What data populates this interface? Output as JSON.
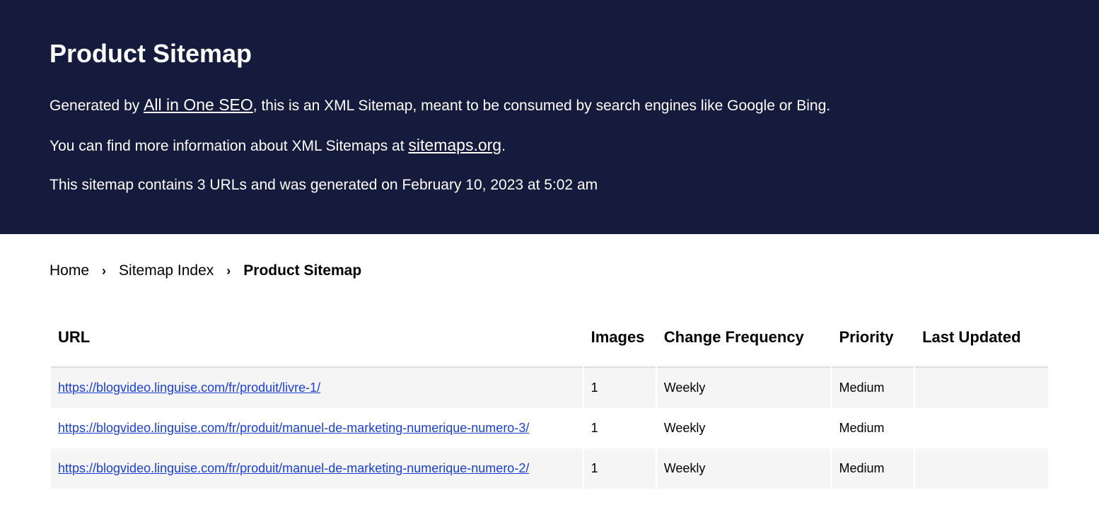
{
  "header": {
    "title": "Product Sitemap",
    "line1_prefix": "Generated by ",
    "line1_link": "All in One SEO",
    "line1_suffix": ", this is an XML Sitemap, meant to be consumed by search engines like Google or Bing.",
    "line2_prefix": "You can find more information about XML Sitemaps at ",
    "line2_link": "sitemaps.org",
    "line2_suffix": ".",
    "line3": "This sitemap contains 3 URLs and was generated on February 10, 2023 at 5:02 am"
  },
  "breadcrumb": {
    "home": "Home",
    "index": "Sitemap Index",
    "current": "Product Sitemap"
  },
  "table": {
    "headers": {
      "url": "URL",
      "images": "Images",
      "freq": "Change Frequency",
      "priority": "Priority",
      "updated": "Last Updated"
    },
    "rows": [
      {
        "url": "https://blogvideo.linguise.com/fr/produit/livre-1/",
        "images": "1",
        "freq": "Weekly",
        "priority": "Medium",
        "updated": ""
      },
      {
        "url": "https://blogvideo.linguise.com/fr/produit/manuel-de-marketing-numerique-numero-3/",
        "images": "1",
        "freq": "Weekly",
        "priority": "Medium",
        "updated": ""
      },
      {
        "url": "https://blogvideo.linguise.com/fr/produit/manuel-de-marketing-numerique-numero-2/",
        "images": "1",
        "freq": "Weekly",
        "priority": "Medium",
        "updated": ""
      }
    ]
  }
}
